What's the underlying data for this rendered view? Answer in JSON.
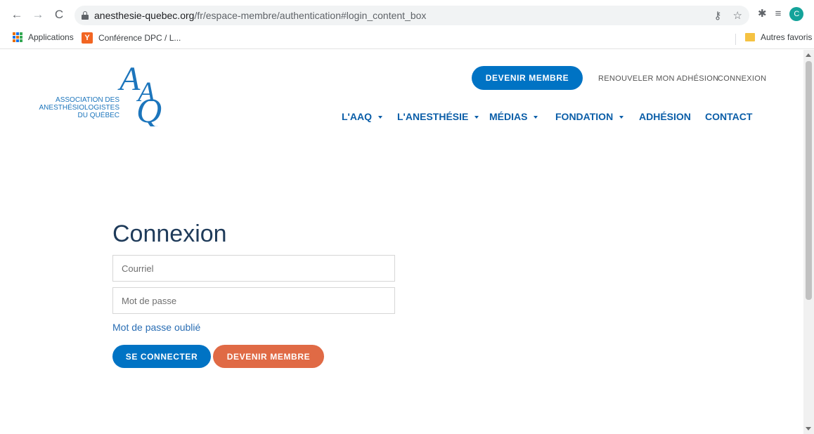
{
  "browser": {
    "url_domain": "anesthesie-quebec.org",
    "url_path": "/fr/espace-membre/authentication#login_content_box",
    "bookmarks": [
      {
        "label": "Applications",
        "icon": "apps-grid-icon"
      },
      {
        "label": "Conférence DPC / L...",
        "icon": "ycombinator-icon"
      }
    ],
    "other_bookmarks": "Autres favoris",
    "profile_initial": "C"
  },
  "site": {
    "logo": {
      "line1": "ASSOCIATION DES",
      "line2": "ANESTHÉSIOLOGISTES",
      "line3": "DU QUÉBEC",
      "monogram": "AAQ"
    },
    "top_bar": {
      "become_member": "DEVENIR MEMBRE",
      "renew": "RENOUVELER MON ADHÉSION",
      "login": "CONNEXION"
    },
    "nav": [
      {
        "label": "L'AAQ",
        "dropdown": true
      },
      {
        "label": "L'ANESTHÉSIE",
        "dropdown": true
      },
      {
        "label": "MÉDIAS",
        "dropdown": true
      },
      {
        "label": "FONDATION",
        "dropdown": true
      },
      {
        "label": "ADHÉSION",
        "dropdown": false
      },
      {
        "label": "CONTACT",
        "dropdown": false
      }
    ]
  },
  "login": {
    "title": "Connexion",
    "email_placeholder": "Courriel",
    "email_value": "",
    "password_placeholder": "Mot de passe",
    "password_value": "",
    "forgot_password": "Mot de passe oublié",
    "submit": "SE CONNECTER",
    "become_member": "DEVENIR MEMBRE"
  },
  "colors": {
    "primary_blue": "#0073c4",
    "nav_blue": "#0b5ea8",
    "title_navy": "#1f3b5a",
    "accent_orange": "#e06a45",
    "link_blue": "#2a6eb4"
  }
}
